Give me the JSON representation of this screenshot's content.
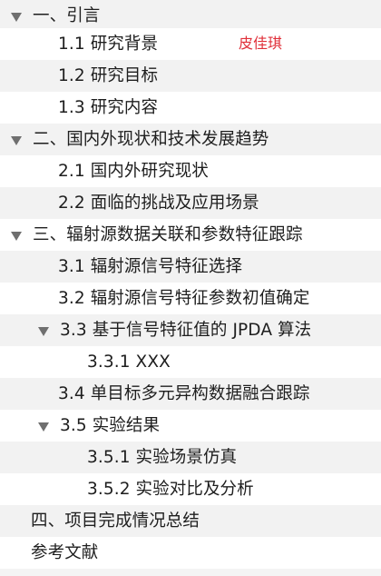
{
  "outline": {
    "items": [
      {
        "label": "一、引言",
        "level": 0,
        "expandable": true
      },
      {
        "label": "1.1 研究背景",
        "level": 1,
        "expandable": false
      },
      {
        "label": "1.2 研究目标",
        "level": 1,
        "expandable": false
      },
      {
        "label": "1.3 研究内容",
        "level": 1,
        "expandable": false
      },
      {
        "label": "二、国内外现状和技术发展趋势",
        "level": 0,
        "expandable": true
      },
      {
        "label": "2.1 国内外研究现状",
        "level": 1,
        "expandable": false
      },
      {
        "label": "2.2 面临的挑战及应用场景",
        "level": 1,
        "expandable": false
      },
      {
        "label": "三、辐射源数据关联和参数特征跟踪",
        "level": 0,
        "expandable": true
      },
      {
        "label": "3.1 辐射源信号特征选择",
        "level": 1,
        "expandable": false
      },
      {
        "label": "3.2 辐射源信号特征参数初值确定",
        "level": 1,
        "expandable": false
      },
      {
        "label": "3.3 基于信号特征值的 JPDA 算法",
        "level": 1,
        "expandable": true
      },
      {
        "label": "3.3.1 XXX",
        "level": 2,
        "expandable": false
      },
      {
        "label": "3.4 单目标多元异构数据融合跟踪",
        "level": 1,
        "expandable": false
      },
      {
        "label": "3.5 实验结果",
        "level": 1,
        "expandable": true
      },
      {
        "label": "3.5.1 实验场景仿真",
        "level": 2,
        "expandable": false
      },
      {
        "label": "3.5.2 实验对比及分析",
        "level": 2,
        "expandable": false
      },
      {
        "label": "四、项目完成情况总结",
        "level": 0,
        "expandable": false
      },
      {
        "label": "参考文献",
        "level": 0,
        "expandable": false
      }
    ]
  },
  "annotation": {
    "author_name": "皮佳琪",
    "color": "#e0303a"
  }
}
